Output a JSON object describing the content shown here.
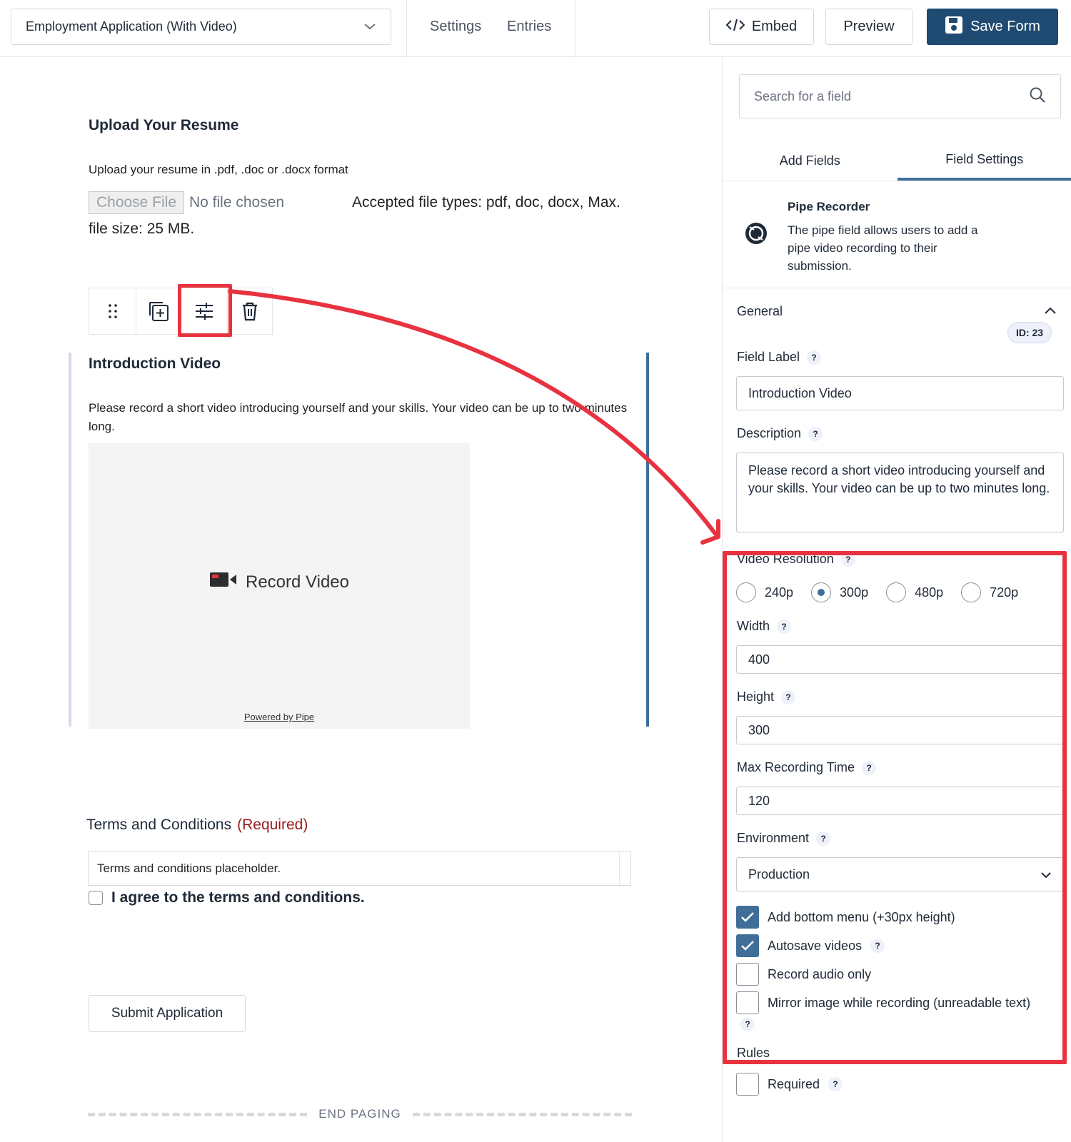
{
  "header": {
    "form_name": "Employment Application (With Video)",
    "settings_link": "Settings",
    "entries_link": "Entries",
    "embed_label": "Embed",
    "preview_label": "Preview",
    "save_label": "Save Form"
  },
  "canvas": {
    "resume": {
      "title": "Upload Your Resume",
      "description": "Upload your resume in .pdf, .doc or .docx format",
      "choose_file": "Choose File",
      "no_file": "No file chosen",
      "accepted": "Accepted file types: pdf, doc, docx, Max.",
      "file_size": "file size: 25 MB."
    },
    "video": {
      "title": "Introduction Video",
      "description": "Please record a short video introducing yourself and your skills. Your video can be up to two minutes long.",
      "record_label": "Record Video",
      "powered_by": "Powered by Pipe"
    },
    "terms": {
      "title": "Terms and Conditions",
      "required": "(Required)",
      "placeholder": "Terms and conditions placeholder.",
      "agree": "I agree to the terms and conditions."
    },
    "submit_label": "Submit Application",
    "end_paging": "END PAGING"
  },
  "sidebar": {
    "search_placeholder": "Search for a field",
    "tabs": [
      "Add Fields",
      "Field Settings"
    ],
    "active_tab": "Field Settings",
    "field_info": {
      "name": "Pipe Recorder",
      "description": "The pipe field allows users to add a pipe video recording to their submission.",
      "id_badge": "ID: 23"
    },
    "section_general": "General",
    "field_label": {
      "label": "Field Label",
      "value": "Introduction Video"
    },
    "description": {
      "label": "Description",
      "value": "Please record a short video introducing yourself and your skills. Your video can be up to two minutes long."
    },
    "video_resolution": {
      "label": "Video Resolution",
      "options": [
        "240p",
        "300p",
        "480p",
        "720p"
      ],
      "selected": "300p"
    },
    "width": {
      "label": "Width",
      "value": "400"
    },
    "height": {
      "label": "Height",
      "value": "300"
    },
    "max_recording_time": {
      "label": "Max Recording Time",
      "value": "120"
    },
    "environment": {
      "label": "Environment",
      "value": "Production"
    },
    "checkboxes": [
      {
        "label": "Add bottom menu (+30px height)",
        "checked": true
      },
      {
        "label": "Autosave videos",
        "checked": true
      },
      {
        "label": "Record audio only",
        "checked": false
      },
      {
        "label": "Mirror image while recording (unreadable text)",
        "checked": false
      }
    ],
    "rules_label": "Rules",
    "required_label": "Required",
    "help_glyph": "?"
  },
  "colors": {
    "primary": "#1f4a72",
    "accent": "#3f6f98",
    "annotation": "#e8323f",
    "required": "#9b1c1c"
  }
}
